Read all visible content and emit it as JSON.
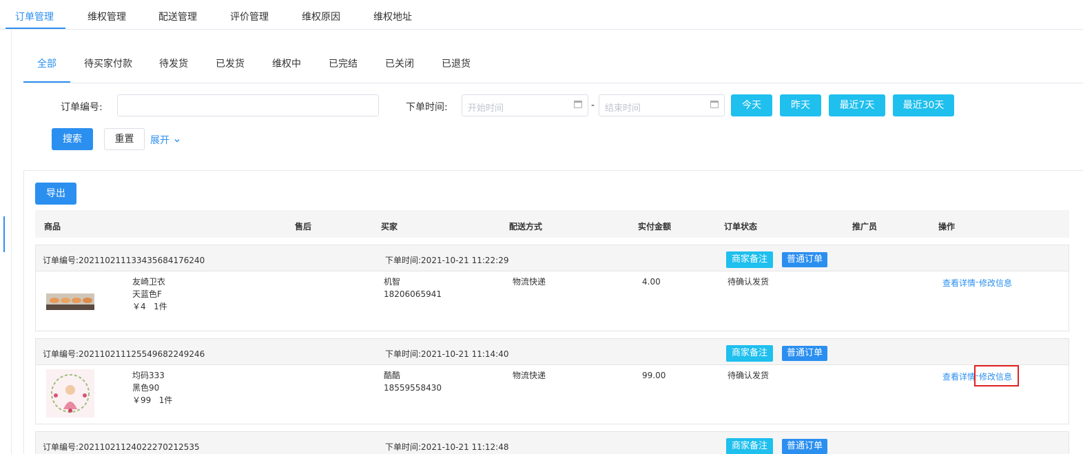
{
  "top_tabs": [
    "订单管理",
    "维权管理",
    "配送管理",
    "评价管理",
    "维权原因",
    "维权地址"
  ],
  "status_tabs": [
    "全部",
    "待买家付款",
    "待发货",
    "已发货",
    "维权中",
    "已完结",
    "已关闭",
    "已退货"
  ],
  "filter": {
    "order_no_label": "订单编号:",
    "order_no_value": "",
    "order_time_label": "下单时间:",
    "start_placeholder": "开始时间",
    "end_placeholder": "结束时间",
    "range_sep": "-",
    "quick": [
      "今天",
      "昨天",
      "最近7天",
      "最近30天"
    ],
    "search": "搜索",
    "reset": "重置",
    "expand": "展开"
  },
  "export_label": "导出",
  "columns": [
    "商品",
    "售后",
    "买家",
    "配送方式",
    "实付金额",
    "订单状态",
    "推广员",
    "操作"
  ],
  "orders": [
    {
      "order_no": "订单编号:20211021113343568417624​0",
      "order_time": "下单时间:2021-10-21 11:22:29",
      "remark_tag": "商家备注",
      "type_tag": "普通订单",
      "product_name": "友崎卫衣",
      "product_spec": "天蓝色F",
      "product_price_qty": "￥4   1件",
      "buyer_name": "机智",
      "buyer_phone": "18206065941",
      "delivery": "物流快递",
      "amount": "4.00",
      "status": "待确认发货",
      "action_detail": "查看详情",
      "action_sep": "-",
      "action_edit": "修改信息"
    },
    {
      "order_no": "订单编号:202110211125549682249246",
      "order_time": "下单时间:2021-10-21 11:14:40",
      "remark_tag": "商家备注",
      "type_tag": "普通订单",
      "product_name": "均码333",
      "product_spec": "黑色90",
      "product_price_qty": "￥99   1件",
      "buyer_name": "酷酷",
      "buyer_phone": "18559558430",
      "delivery": "物流快递",
      "amount": "99.00",
      "status": "待确认发货",
      "action_detail": "查看详情",
      "action_sep": "-",
      "action_edit": "修改信息"
    },
    {
      "order_no": "订单编号:202110211240222702125​35",
      "order_time": "下单时间:2021-10-21 11:12:48",
      "remark_tag": "商家备注",
      "type_tag": "普通订单"
    }
  ]
}
